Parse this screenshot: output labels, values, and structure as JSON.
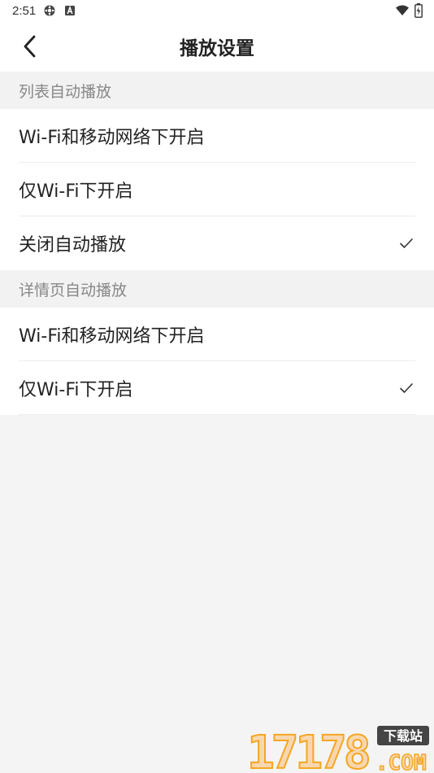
{
  "status_bar": {
    "time": "2:51",
    "icons": [
      "settings-cog-icon",
      "a-notification-icon",
      "wifi-icon",
      "battery-icon"
    ]
  },
  "header": {
    "title": "播放设置",
    "back_icon": "chevron-left-icon"
  },
  "sections": [
    {
      "title": "列表自动播放",
      "options": [
        {
          "label": "Wi-Fi和移动网络下开启",
          "selected": false
        },
        {
          "label": "仅Wi-Fi下开启",
          "selected": false
        },
        {
          "label": "关闭自动播放",
          "selected": true
        }
      ]
    },
    {
      "title": "详情页自动播放",
      "options": [
        {
          "label": "Wi-Fi和移动网络下开启",
          "selected": false
        },
        {
          "label": "仅Wi-Fi下开启",
          "selected": true
        }
      ]
    }
  ],
  "watermark": {
    "number": "17178",
    "tag": "下载站",
    "domain": ".COM"
  },
  "colors": {
    "accent_check": "#333333",
    "section_bg": "#f2f2f2",
    "watermark_orange": "#f5a623"
  }
}
